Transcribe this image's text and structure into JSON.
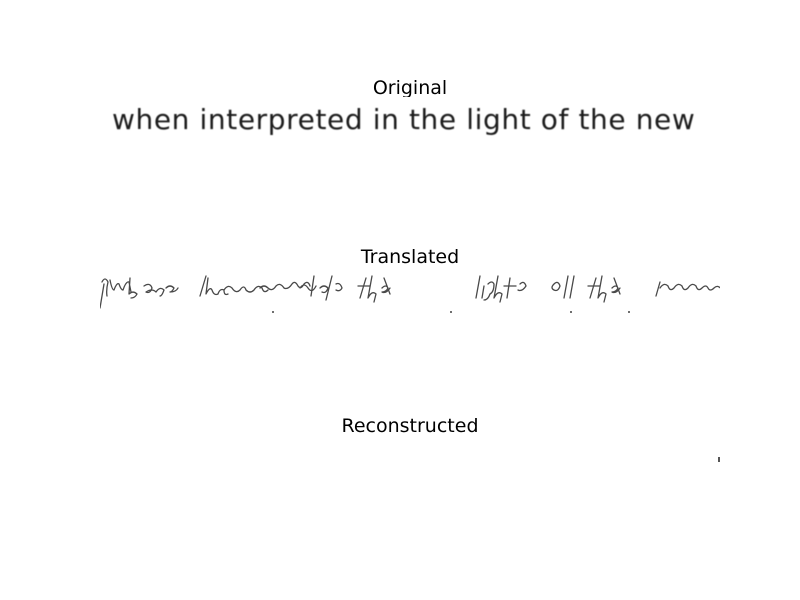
{
  "figure": {
    "panels": [
      {
        "title": "Original",
        "text": "when interpreted in the light of the new"
      },
      {
        "title": "Translated"
      },
      {
        "title": "Reconstructed"
      }
    ]
  }
}
